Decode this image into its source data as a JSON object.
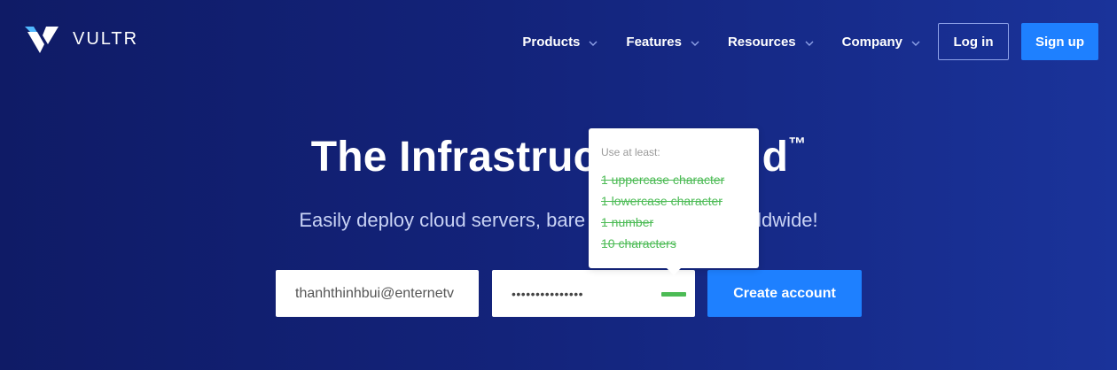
{
  "brand": {
    "name": "VULTR"
  },
  "nav": {
    "items": [
      {
        "label": "Products"
      },
      {
        "label": "Features"
      },
      {
        "label": "Resources"
      },
      {
        "label": "Company"
      }
    ],
    "login_label": "Log in",
    "signup_label": "Sign up"
  },
  "hero": {
    "title": "The Infrastruc",
    "title_tail": "d",
    "trademark": "™",
    "subtitle_start": "Easily deploy cloud servers, bare m",
    "subtitle_end": "orldwide!"
  },
  "form": {
    "email_value": "thanhthinhbui@enternetv",
    "password_value": "•••••••••••••••",
    "create_label": "Create account"
  },
  "tooltip": {
    "heading": "Use at least:",
    "rules": [
      "1 uppercase character",
      "1 lowercase character",
      "1 number",
      "10 characters"
    ]
  },
  "colors": {
    "accent": "#1e80ff",
    "success": "#4cbb55"
  },
  "icons": {
    "nav_chevron": "chevron-down-icon"
  }
}
